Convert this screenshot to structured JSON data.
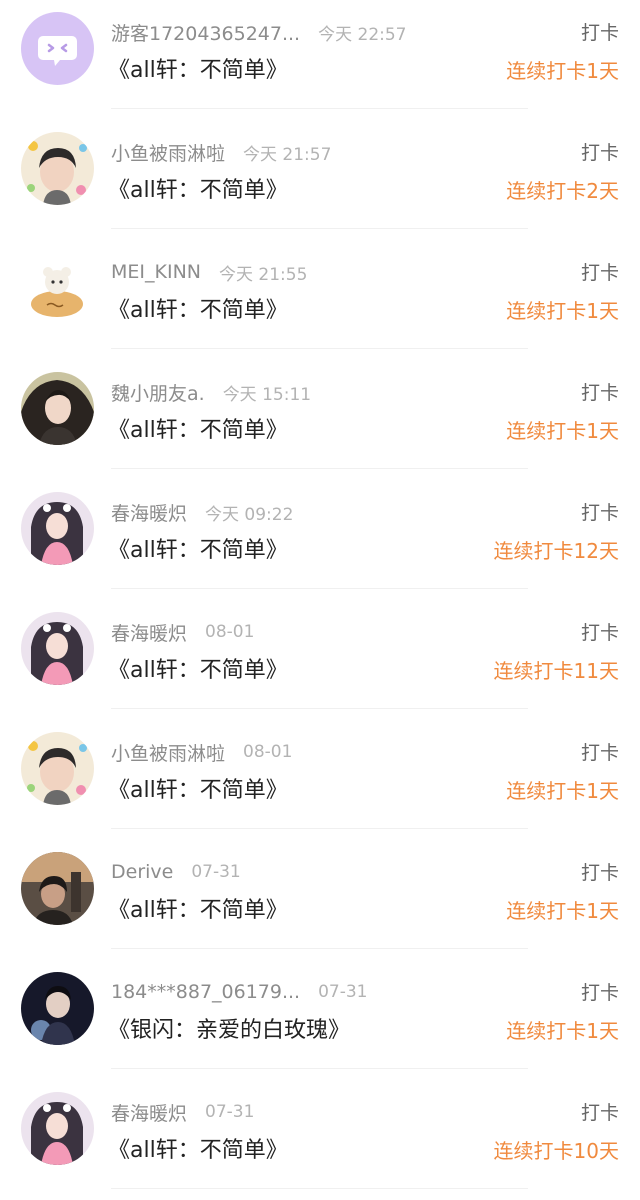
{
  "action_label": "打卡",
  "records": [
    {
      "user": "游客17204365247...",
      "time": "今天 22:57",
      "book": "《all轩：不简单》",
      "streak": "连续打卡1天",
      "avatar": "default-avatar-icon"
    },
    {
      "user": "小鱼被雨淋啦",
      "time": "今天 21:57",
      "book": "《all轩：不简单》",
      "streak": "连续打卡2天",
      "avatar": "user-avatar"
    },
    {
      "user": "MEI_KINN",
      "time": "今天 21:55",
      "book": "《all轩：不简单》",
      "streak": "连续打卡1天",
      "avatar": "user-avatar"
    },
    {
      "user": "魏小朋友a.",
      "time": "今天 15:11",
      "book": "《all轩：不简单》",
      "streak": "连续打卡1天",
      "avatar": "user-avatar"
    },
    {
      "user": "春海暖炽",
      "time": "今天 09:22",
      "book": "《all轩：不简单》",
      "streak": "连续打卡12天",
      "avatar": "user-avatar"
    },
    {
      "user": "春海暖炽",
      "time": "08-01",
      "book": "《all轩：不简单》",
      "streak": "连续打卡11天",
      "avatar": "user-avatar"
    },
    {
      "user": "小鱼被雨淋啦",
      "time": "08-01",
      "book": "《all轩：不简单》",
      "streak": "连续打卡1天",
      "avatar": "user-avatar"
    },
    {
      "user": "Derive",
      "time": "07-31",
      "book": "《all轩：不简单》",
      "streak": "连续打卡1天",
      "avatar": "user-avatar"
    },
    {
      "user": "184***887_06179...",
      "time": "07-31",
      "book": "《银闪：亲爱的白玫瑰》",
      "streak": "连续打卡1天",
      "avatar": "user-avatar"
    },
    {
      "user": "春海暖炽",
      "time": "07-31",
      "book": "《all轩：不简单》",
      "streak": "连续打卡10天",
      "avatar": "user-avatar"
    }
  ]
}
